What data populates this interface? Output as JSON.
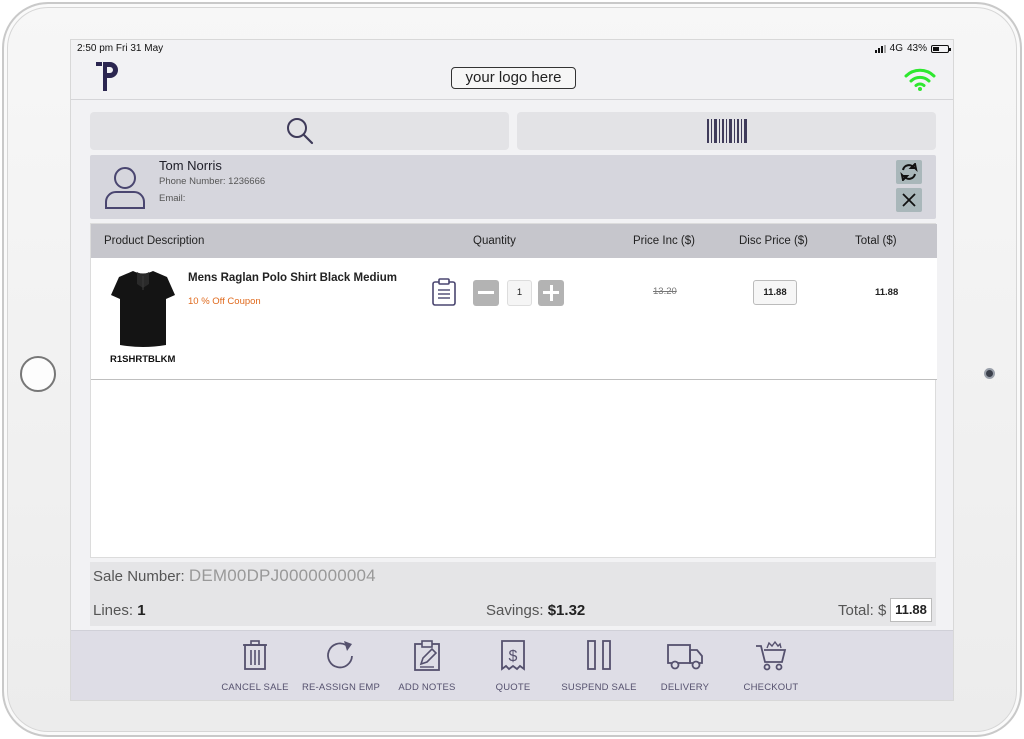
{
  "status_bar": {
    "time": "2:50 pm  Fri 31 May",
    "network": "4G",
    "battery": "43%",
    "battery_level": 0.43
  },
  "header": {
    "logo_placeholder": "your logo here"
  },
  "customer": {
    "name": "Tom Norris",
    "phone": "Phone Number: 1236666",
    "email": "Email:"
  },
  "table": {
    "headers": {
      "description": "Product Description",
      "quantity": "Quantity",
      "price_inc": "Price Inc ($)",
      "disc_price": "Disc Price ($)",
      "total": "Total ($)"
    },
    "rows": [
      {
        "name": "Mens Raglan Polo Shirt Black Medium",
        "coupon": "10 % Off Coupon",
        "sku": "R1SHRTBLKM",
        "quantity": "1",
        "original_price": "13.20",
        "disc_price": "11.88",
        "total": "11.88"
      }
    ]
  },
  "summary": {
    "sale_label": "Sale Number:",
    "sale_number": "DEM00DPJ0000000004",
    "lines_label": "Lines:",
    "lines": "1",
    "savings_label": "Savings:",
    "savings": "$1.32",
    "total_label": "Total: $",
    "total": "11.88"
  },
  "actions": {
    "cancel": "CANCEL SALE",
    "reassign": "RE-ASSIGN EMP",
    "notes": "ADD NOTES",
    "quote": "QUOTE",
    "suspend": "SUSPEND SALE",
    "delivery": "DELIVERY",
    "checkout": "CHECKOUT"
  },
  "colors": {
    "brand": "#2b2650",
    "wifi": "#2ee82e",
    "coupon": "#e06a1d",
    "footer_icons": "#55516e"
  }
}
